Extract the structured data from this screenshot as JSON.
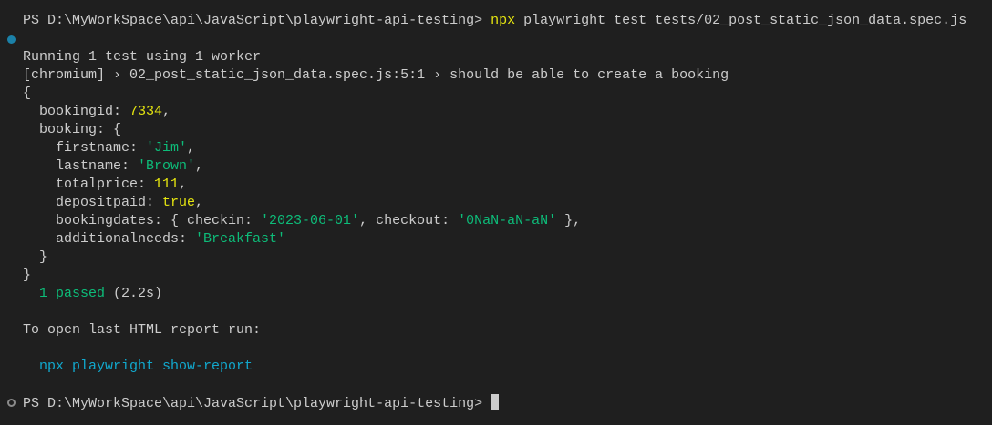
{
  "terminal": {
    "lines": [
      [
        {
          "t": "PS D:\\MyWorkSpace\\api\\JavaScript\\playwright-api-testing> ",
          "c": "default"
        },
        {
          "t": "npx",
          "c": "yellow"
        },
        {
          "t": " playwright test tests/02_post_static_json_data.spec.js",
          "c": "default"
        }
      ],
      [],
      [
        {
          "t": "Running 1 test using 1 worker",
          "c": "default"
        }
      ],
      [
        {
          "t": "[chromium] › 02_post_static_json_data.spec.js:5:1 › should be able to create a booking",
          "c": "default"
        }
      ],
      [
        {
          "t": "{",
          "c": "default"
        }
      ],
      [
        {
          "t": "  bookingid: ",
          "c": "default"
        },
        {
          "t": "7334",
          "c": "yellow"
        },
        {
          "t": ",",
          "c": "default"
        }
      ],
      [
        {
          "t": "  booking: {",
          "c": "default"
        }
      ],
      [
        {
          "t": "    firstname: ",
          "c": "default"
        },
        {
          "t": "'Jim'",
          "c": "green"
        },
        {
          "t": ",",
          "c": "default"
        }
      ],
      [
        {
          "t": "    lastname: ",
          "c": "default"
        },
        {
          "t": "'Brown'",
          "c": "green"
        },
        {
          "t": ",",
          "c": "default"
        }
      ],
      [
        {
          "t": "    totalprice: ",
          "c": "default"
        },
        {
          "t": "111",
          "c": "yellow"
        },
        {
          "t": ",",
          "c": "default"
        }
      ],
      [
        {
          "t": "    depositpaid: ",
          "c": "default"
        },
        {
          "t": "true",
          "c": "yellow"
        },
        {
          "t": ",",
          "c": "default"
        }
      ],
      [
        {
          "t": "    bookingdates: { checkin: ",
          "c": "default"
        },
        {
          "t": "'2023-06-01'",
          "c": "green"
        },
        {
          "t": ", checkout: ",
          "c": "default"
        },
        {
          "t": "'0NaN-aN-aN'",
          "c": "green"
        },
        {
          "t": " },",
          "c": "default"
        }
      ],
      [
        {
          "t": "    additionalneeds: ",
          "c": "default"
        },
        {
          "t": "'Breakfast'",
          "c": "green"
        }
      ],
      [
        {
          "t": "  }",
          "c": "default"
        }
      ],
      [
        {
          "t": "}",
          "c": "default"
        }
      ],
      [
        {
          "t": "  ",
          "c": "default"
        },
        {
          "t": "1 passed",
          "c": "green"
        },
        {
          "t": " (2.2s)",
          "c": "default"
        }
      ],
      [],
      [
        {
          "t": "To open last HTML report run:",
          "c": "default"
        }
      ],
      [],
      [
        {
          "t": "  ",
          "c": "default"
        },
        {
          "t": "npx playwright show-report",
          "c": "blue"
        }
      ],
      [],
      [
        {
          "t": "PS D:\\MyWorkSpace\\api\\JavaScript\\playwright-api-testing> ",
          "c": "default"
        }
      ]
    ]
  },
  "colors": {
    "background": "#1f1f1f",
    "text": "#cccccc",
    "yellow": "#e5e510",
    "green": "#0dbc79",
    "blue": "#11a8cd"
  }
}
